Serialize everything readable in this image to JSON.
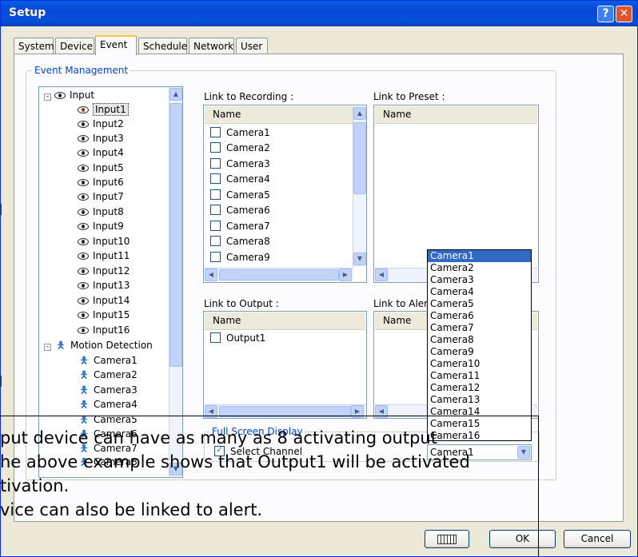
{
  "window": {
    "title": "Setup",
    "help_label": "?",
    "close_label": "✕"
  },
  "tabs": [
    {
      "label": "System"
    },
    {
      "label": "Device"
    },
    {
      "label": "Event",
      "active": true
    },
    {
      "label": "Schedule"
    },
    {
      "label": "Network"
    },
    {
      "label": "User"
    }
  ],
  "event_management": {
    "label": "Event Management",
    "tree": {
      "input_root": "Input",
      "inputs": [
        "Input1",
        "Input2",
        "Input3",
        "Input4",
        "Input5",
        "Input6",
        "Input7",
        "Input8",
        "Input9",
        "Input10",
        "Input11",
        "Input12",
        "Input13",
        "Input14",
        "Input15",
        "Input16"
      ],
      "selected": "Input1",
      "motion_root": "Motion Detection",
      "cameras": [
        "Camera1",
        "Camera2",
        "Camera3",
        "Camera4",
        "Camera5",
        "Camera6",
        "Camera7",
        "Camera8"
      ]
    }
  },
  "link_recording": {
    "label": "Link to Recording :",
    "column": "Name",
    "items": [
      "Camera1",
      "Camera2",
      "Camera3",
      "Camera4",
      "Camera5",
      "Camera6",
      "Camera7",
      "Camera8",
      "Camera9"
    ]
  },
  "link_preset": {
    "label": "Link to Preset :",
    "column": "Name"
  },
  "link_output": {
    "label": "Link to Output :",
    "column": "Name",
    "items": [
      "Output1"
    ]
  },
  "link_alert": {
    "label": "Link to Alert",
    "column": "Name"
  },
  "camera_dropdown": {
    "options": [
      "Camera1",
      "Camera2",
      "Camera3",
      "Camera4",
      "Camera5",
      "Camera6",
      "Camera7",
      "Camera8",
      "Camera9",
      "Camera10",
      "Camera11",
      "Camera12",
      "Camera13",
      "Camera14",
      "Camera15",
      "Camera16"
    ],
    "highlighted": "Camera1",
    "selected_value": "Camera1"
  },
  "full_screen": {
    "label": "Full Screen Display",
    "checkbox_label": "Select Channel",
    "checked": true
  },
  "buttons": {
    "ok": "OK",
    "cancel": "Cancel",
    "keyboard_icon": "keyboard-icon"
  },
  "overlay_text": {
    "line1": "put device can have as many as 8 activating output",
    "line2": "he above example shows that Output1 will be activated",
    "line3": "tivation.",
    "line4": "vice can also be linked to alert."
  },
  "colors": {
    "titlebar": "#0a5ce4",
    "selection": "#316ac5",
    "group_label": "#0046d5"
  }
}
